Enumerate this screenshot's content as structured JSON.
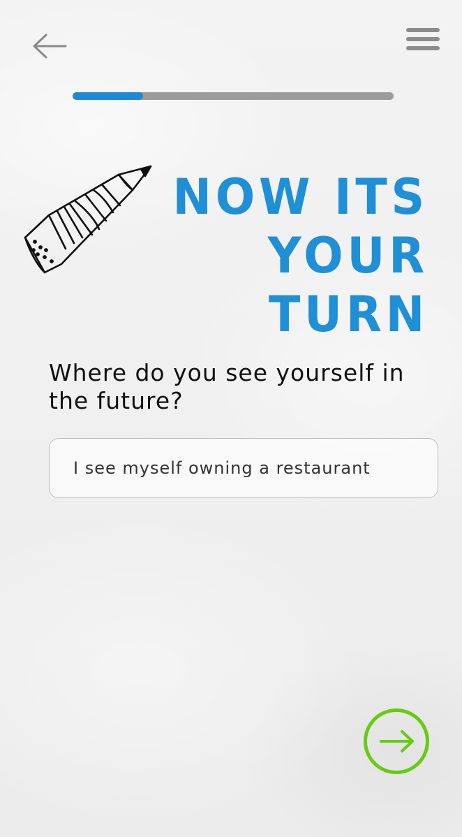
{
  "header": {
    "back_icon": "arrow-left-icon",
    "menu_icon": "hamburger-menu-icon"
  },
  "progress": {
    "fraction": 0.22,
    "fill_color": "#2188d6",
    "track_color": "#9c9c9c"
  },
  "hero": {
    "illustration": "pencil-icon",
    "heading_line1": "NOW ITS",
    "heading_line2": "YOUR TURN",
    "heading_color": "#1f8fd6"
  },
  "question": {
    "text": "Where do you see yourself in the future?"
  },
  "answer": {
    "value": "I see myself owning a restaurant"
  },
  "footer": {
    "next_icon": "arrow-right-icon",
    "next_color": "#66cc11"
  }
}
